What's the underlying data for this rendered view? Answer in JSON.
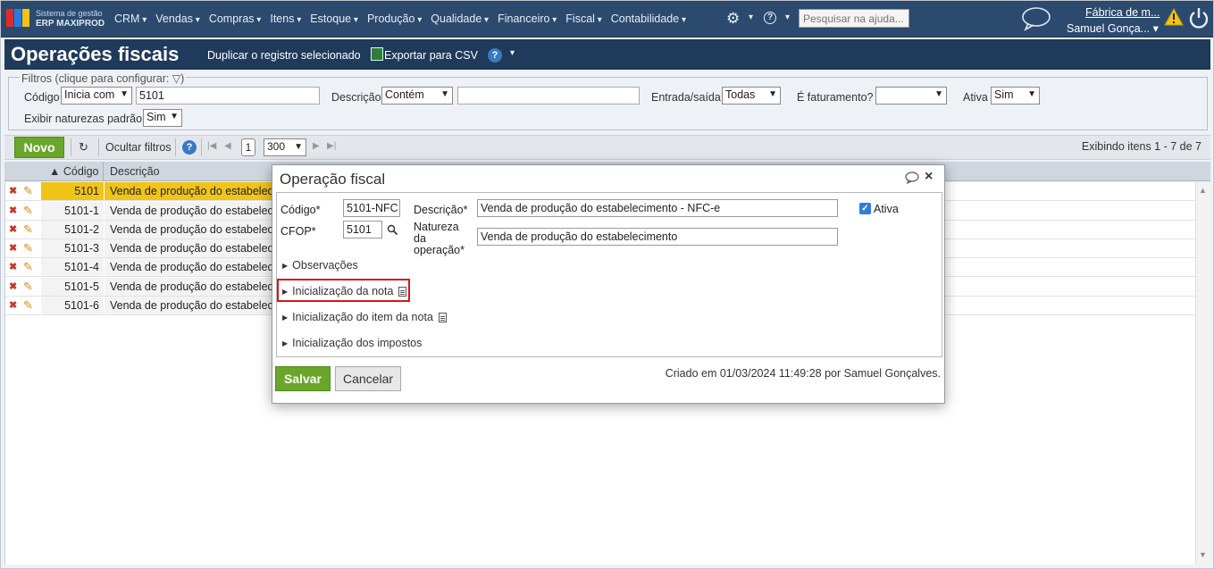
{
  "app": {
    "brand_line1": "Sistema de gestão",
    "brand_line2": "ERP MAXIPROD",
    "menu": [
      "CRM",
      "Vendas",
      "Compras",
      "Itens",
      "Estoque",
      "Produção",
      "Qualidade",
      "Financeiro",
      "Fiscal",
      "Contabilidade"
    ],
    "search_placeholder": "Pesquisar na ajuda...",
    "company": "Fábrica de m...",
    "user": "Samuel Gonça... ▾",
    "icons": {
      "settings": "gear-icon",
      "help": "help-icon",
      "chat": "chat-icon",
      "warning": "warning-icon",
      "power": "power-icon"
    }
  },
  "page": {
    "title": "Operações fiscais",
    "actions": {
      "duplicate": "Duplicar o registro selecionado",
      "export_csv": "Exportar para CSV"
    }
  },
  "filters": {
    "legend": "Filtros (clique para configurar:",
    "legend_close": ")",
    "codigo_label": "Código",
    "codigo_op": "Inicia com",
    "codigo_value": "5101",
    "descricao_label": "Descrição",
    "descricao_op": "Contém",
    "descricao_value": "",
    "entrada_label": "Entrada/saída",
    "entrada_value": "Todas",
    "faturamento_label": "É faturamento?",
    "faturamento_value": "",
    "ativa_label": "Ativa",
    "ativa_value": "Sim",
    "naturezas_label": "Exibir naturezas padrão",
    "naturezas_value": "Sim"
  },
  "toolbar": {
    "new_label": "Novo",
    "hide_filters": "Ocultar filtros",
    "page": "1",
    "per_page": "300",
    "display_info": "Exibindo itens 1 - 7 de 7"
  },
  "grid": {
    "columns": {
      "code": "Código",
      "desc": "Descrição"
    },
    "rows": [
      {
        "code": "5101",
        "desc": "Venda de produção do estabelecimento"
      },
      {
        "code": "5101-1",
        "desc": "Venda de produção do estabelecimento"
      },
      {
        "code": "5101-2",
        "desc": "Venda de produção do estabelecimento"
      },
      {
        "code": "5101-3",
        "desc": "Venda de produção do estabelecimento"
      },
      {
        "code": "5101-4",
        "desc": "Venda de produção do estabelecimento"
      },
      {
        "code": "5101-5",
        "desc": "Venda de produção do estabelecimento"
      },
      {
        "code": "5101-6",
        "desc": "Venda de produção do estabelecimento"
      }
    ]
  },
  "modal": {
    "title": "Operação fiscal",
    "codigo_label": "Código*",
    "codigo_value": "5101-NFC",
    "cfop_label": "CFOP*",
    "cfop_value": "5101",
    "descricao_label": "Descrição*",
    "descricao_value": "Venda de produção do estabelecimento - NFC-e",
    "natureza_label_1": "Natureza",
    "natureza_label_2": "da",
    "natureza_label_3": "operação*",
    "natureza_value": "Venda de produção do estabelecimento",
    "ativa_label": "Ativa",
    "sections": [
      "Observações",
      "Inicialização da nota",
      "Inicialização do item da nota",
      "Inicialização dos impostos"
    ],
    "save_label": "Salvar",
    "cancel_label": "Cancelar",
    "created_info": "Criado em 01/03/2024 11:49:28 por Samuel Gonçalves.",
    "highlight_color": "#d9141b"
  }
}
